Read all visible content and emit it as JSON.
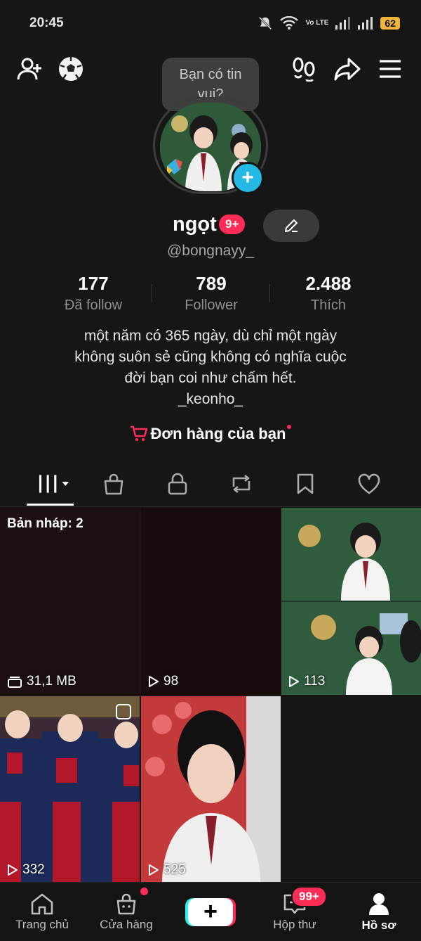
{
  "status_bar": {
    "time": "20:45",
    "network": "Vo LTE",
    "battery": "62"
  },
  "top_bar": {
    "bubble_text": "Bạn có tin vui?"
  },
  "profile": {
    "username": "ngọt",
    "notif_badge": "9+",
    "handle": "@bongnayy_",
    "bio": "một năm có 365 ngày, dù chỉ một ngày\nkhông suôn sẻ cũng không có nghĩa cuộc\nđời bạn coi như chấm hết.\n_keonho_",
    "orders_label": "Đơn hàng của bạn"
  },
  "stats": [
    {
      "value": "177",
      "label": "Đã follow"
    },
    {
      "value": "789",
      "label": "Follower"
    },
    {
      "value": "2.488",
      "label": "Thích"
    }
  ],
  "grid": {
    "draft_label": "Bản nháp: 2",
    "draft_size": "31,1 MB",
    "tiles": [
      {
        "views": "98"
      },
      {
        "views": "113"
      },
      {
        "views": "332"
      },
      {
        "views": "525"
      }
    ]
  },
  "bottom_nav": {
    "home": "Trang chủ",
    "shop": "Cửa hàng",
    "inbox": "Hộp thư",
    "inbox_badge": "99+",
    "profile": "Hồ sơ"
  },
  "colors": {
    "accent_red": "#ff2d55",
    "accent_cyan": "#25b9e6",
    "background": "#161616"
  }
}
